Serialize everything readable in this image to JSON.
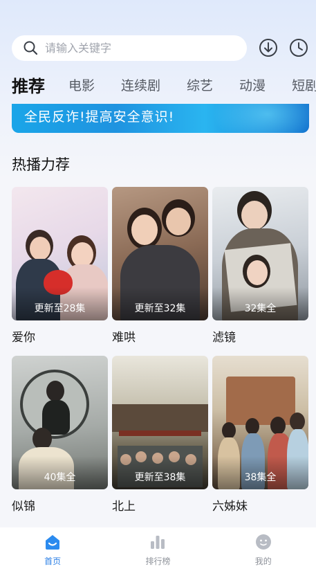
{
  "search": {
    "placeholder": "请输入关键字"
  },
  "header_icons": [
    "download-icon",
    "history-clock-icon"
  ],
  "tabs": [
    {
      "label": "推荐",
      "active": true
    },
    {
      "label": "电影"
    },
    {
      "label": "连续剧"
    },
    {
      "label": "综艺"
    },
    {
      "label": "动漫"
    },
    {
      "label": "短剧"
    }
  ],
  "banner": {
    "text": "全民反诈!提高安全意识!"
  },
  "section": {
    "title": "热播力荐"
  },
  "items": [
    {
      "title": "爱你",
      "badge": "更新至28集"
    },
    {
      "title": "难哄",
      "badge": "更新至32集"
    },
    {
      "title": "滤镜",
      "badge": "32集全"
    },
    {
      "title": "似锦",
      "badge": "40集全"
    },
    {
      "title": "北上",
      "badge": "更新至38集"
    },
    {
      "title": "六姊妹",
      "badge": "38集全"
    }
  ],
  "tabbar": [
    {
      "label": "首页",
      "icon": "home-icon",
      "active": true
    },
    {
      "label": "排行榜",
      "icon": "ranking-icon"
    },
    {
      "label": "我的",
      "icon": "profile-icon"
    }
  ],
  "colors": {
    "accent": "#2b7fe6",
    "background": "#f5f6fa"
  }
}
